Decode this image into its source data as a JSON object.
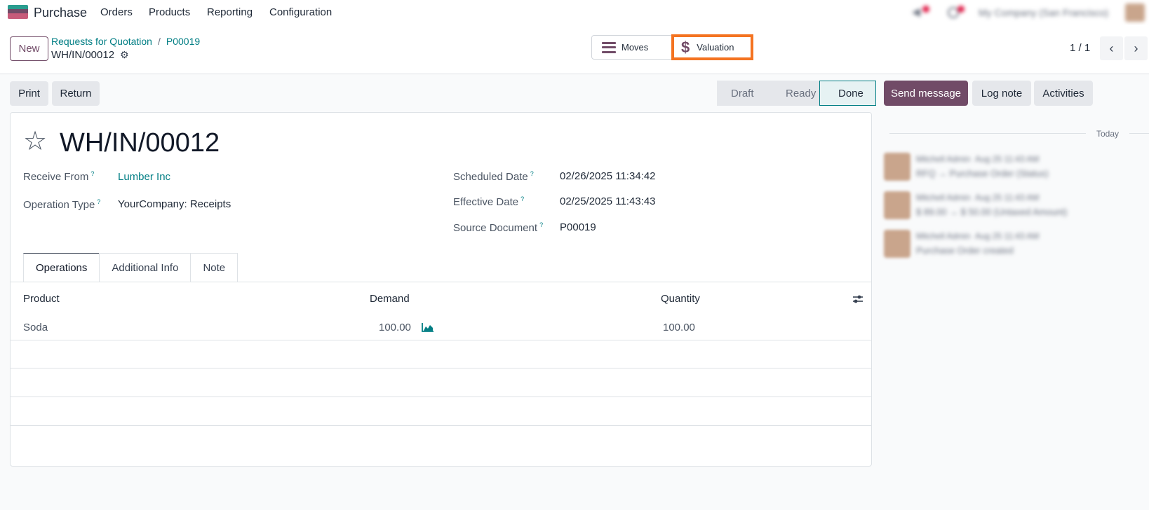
{
  "navbar": {
    "app_name": "Purchase",
    "menu": [
      "Orders",
      "Products",
      "Reporting",
      "Configuration"
    ],
    "company": "My Company (San Francisco)"
  },
  "control": {
    "new_label": "New",
    "breadcrumb": [
      "Requests for Quotation",
      "P00019"
    ],
    "record": "WH/IN/00012",
    "smart_buttons": {
      "moves": "Moves",
      "valuation": "Valuation"
    },
    "pager": "1 / 1"
  },
  "actions": {
    "print": "Print",
    "return": "Return"
  },
  "statusbar": [
    "Draft",
    "Ready",
    "Done"
  ],
  "form": {
    "title": "WH/IN/00012",
    "fields": {
      "receive_from_label": "Receive From",
      "receive_from": "Lumber Inc",
      "operation_type_label": "Operation Type",
      "operation_type": "YourCompany: Receipts",
      "scheduled_date_label": "Scheduled Date",
      "scheduled_date": "02/26/2025 11:34:42",
      "effective_date_label": "Effective Date",
      "effective_date": "02/25/2025 11:43:43",
      "source_document_label": "Source Document",
      "source_document": "P00019",
      "help": "?"
    },
    "tabs": [
      "Operations",
      "Additional Info",
      "Note"
    ],
    "table": {
      "headers": [
        "Product",
        "Demand",
        "Quantity"
      ],
      "rows": [
        {
          "product": "Soda",
          "demand": "100.00",
          "quantity": "100.00"
        }
      ]
    }
  },
  "chatter": {
    "send_message": "Send message",
    "log_note": "Log note",
    "activities": "Activities",
    "today": "Today",
    "messages": [
      {
        "author": "Mitchell Admin",
        "time": "Aug 25 11:43 AM",
        "body": "RFQ → Purchase Order (Status)"
      },
      {
        "author": "Mitchell Admin",
        "time": "Aug 25 11:43 AM",
        "body": "$ 89.00 → $ 50.00 (Untaxed Amount)"
      },
      {
        "author": "Mitchell Admin",
        "time": "Aug 25 11:43 AM",
        "body": "Purchase Order created"
      }
    ]
  }
}
